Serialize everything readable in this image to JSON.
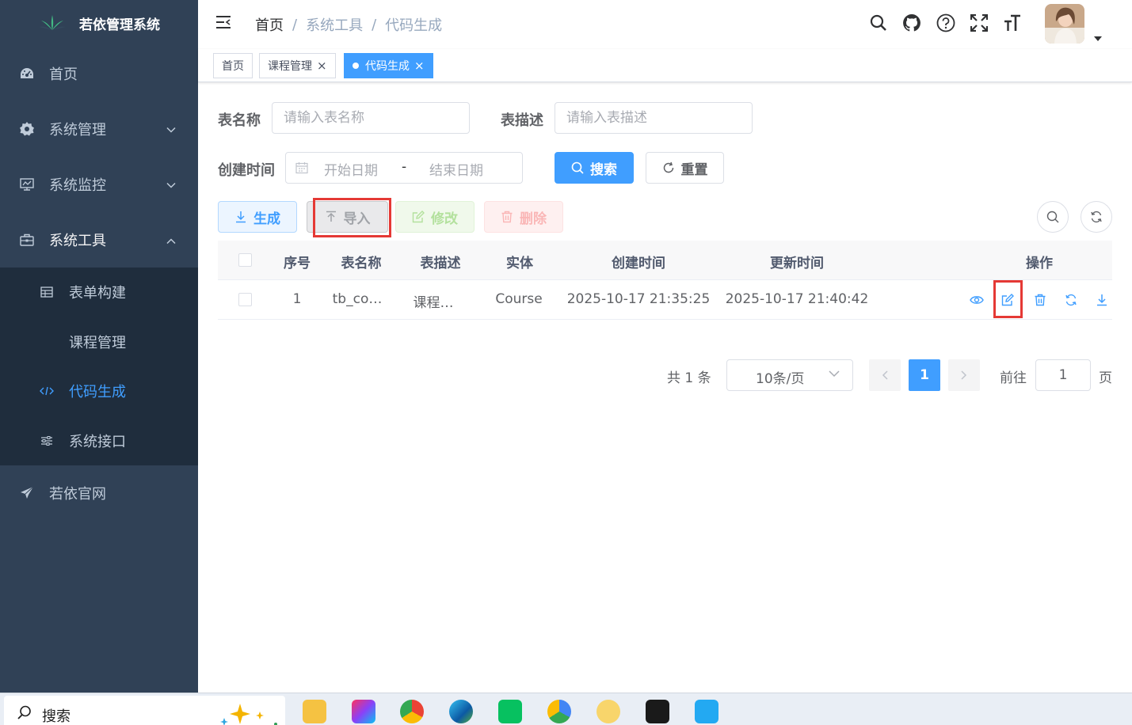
{
  "app": {
    "title": "若依管理系统"
  },
  "sidebar": {
    "items": [
      {
        "label": "首页",
        "icon": "dashboard-icon"
      },
      {
        "label": "系统管理",
        "icon": "gear-icon"
      },
      {
        "label": "系统监控",
        "icon": "monitor-icon"
      },
      {
        "label": "系统工具",
        "icon": "toolbox-icon"
      },
      {
        "label": "若依官网",
        "icon": "send-icon"
      }
    ],
    "submenu": [
      {
        "label": "表单构建",
        "icon": "form-icon"
      },
      {
        "label": "课程管理",
        "icon": ""
      },
      {
        "label": "代码生成",
        "icon": "code-icon"
      },
      {
        "label": "系统接口",
        "icon": "sliders-icon"
      }
    ]
  },
  "breadcrumb": {
    "home": "首页",
    "level1": "系统工具",
    "level2": "代码生成"
  },
  "tags": {
    "home": "首页",
    "course": "课程管理",
    "codegen": "代码生成"
  },
  "search": {
    "table_name_label": "表名称",
    "table_name_placeholder": "请输入表名称",
    "table_desc_label": "表描述",
    "table_desc_placeholder": "请输入表描述",
    "create_time_label": "创建时间",
    "start_placeholder": "开始日期",
    "range_sep": "-",
    "end_placeholder": "结束日期",
    "search_btn": "搜索",
    "reset_btn": "重置"
  },
  "toolbar": {
    "generate": "生成",
    "import": "导入",
    "edit": "修改",
    "delete": "删除"
  },
  "table": {
    "headers": {
      "index": "序号",
      "table_name": "表名称",
      "table_desc": "表描述",
      "entity": "实体",
      "create_time": "创建时间",
      "update_time": "更新时间",
      "actions": "操作"
    },
    "rows": [
      {
        "index": "1",
        "table_name": "tb_co…",
        "table_desc": "课程…",
        "entity": "Course",
        "create_time": "2025-10-17 21:35:25",
        "update_time": "2025-10-17 21:40:42"
      }
    ]
  },
  "pagination": {
    "total": "共 1 条",
    "page_size": "10条/页",
    "current": "1",
    "goto_label": "前往",
    "goto_value": "1",
    "goto_unit": "页"
  },
  "taskbar": {
    "search": "搜索"
  },
  "colors": {
    "primary": "#409eff",
    "sidebar": "#304156",
    "submenu": "#1f2d3d",
    "highlight": "#e53935"
  }
}
